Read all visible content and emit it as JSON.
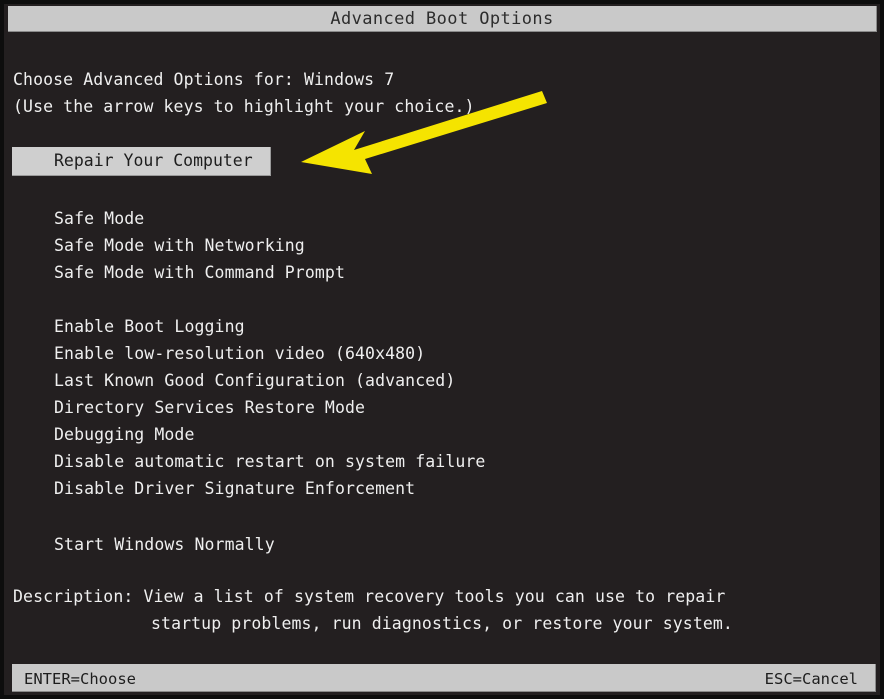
{
  "window": {
    "title": "Advanced Boot Options"
  },
  "prompt": {
    "line1": "Choose Advanced Options for: Windows 7",
    "line2": "(Use the arrow keys to highlight your choice.)"
  },
  "selected_option": {
    "label": "Repair Your Computer",
    "highlight_bg": "#cfcfcf",
    "highlight_fg": "#1d1d1d"
  },
  "menu_groups": [
    {
      "items": [
        "Safe Mode",
        "Safe Mode with Networking",
        "Safe Mode with Command Prompt"
      ]
    },
    {
      "items": [
        "Enable Boot Logging",
        "Enable low-resolution video (640x480)",
        "Last Known Good Configuration (advanced)",
        "Directory Services Restore Mode",
        "Debugging Mode",
        "Disable automatic restart on system failure",
        "Disable Driver Signature Enforcement"
      ]
    },
    {
      "items": [
        "Start Windows Normally"
      ]
    }
  ],
  "description": {
    "line1": "Description: View a list of system recovery tools you can use to repair",
    "line2": "startup problems, run diagnostics, or restore your system."
  },
  "footer": {
    "left": "ENTER=Choose",
    "right": "ESC=Cancel"
  },
  "annotation": {
    "arrow_icon": "left-pointing-arrow-icon",
    "color": "#f5e400"
  },
  "colors": {
    "screen_bg": "#231f20",
    "bar_bg": "#c9c9c9",
    "text_fg": "#efefef",
    "bar_fg": "#2d2d2d"
  }
}
